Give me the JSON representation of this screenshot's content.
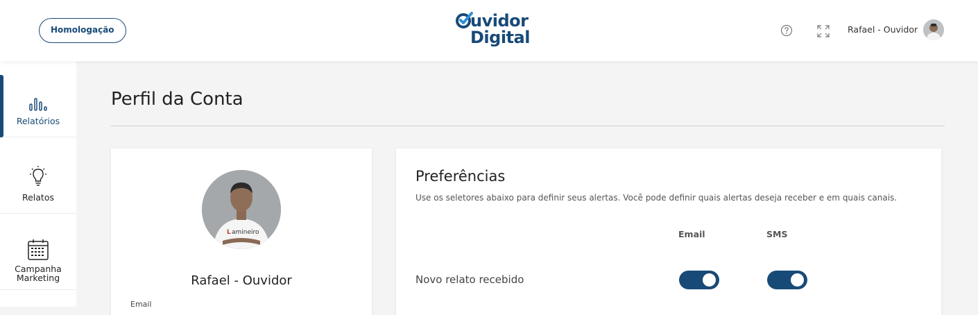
{
  "header": {
    "env_label": "Homologação",
    "logo_line1": "uvidor",
    "logo_line2": "Digital",
    "user_name": "Rafael - Ouvidor"
  },
  "sidebar": {
    "items": [
      {
        "label": "Relatórios",
        "icon": "bar-chart-icon",
        "active": true
      },
      {
        "label": "Relatos",
        "icon": "lightbulb-icon",
        "active": false
      },
      {
        "label_line1": "Campanha",
        "label_line2": "Marketing",
        "icon": "calendar-icon",
        "active": false
      }
    ]
  },
  "main": {
    "title": "Perfil da Conta",
    "profile": {
      "name": "Rafael - Ouvidor",
      "email_label": "Email"
    },
    "preferences": {
      "title": "Preferências",
      "description": "Use os seletores abaixo para definir seus alertas. Você pode definir quais alertas deseja receber e em quais canais.",
      "columns": [
        "Email",
        "SMS"
      ],
      "rows": [
        {
          "label": "Novo relato recebido",
          "email": true,
          "sms": true
        }
      ]
    }
  },
  "colors": {
    "brand": "#184a78",
    "logo_check": "#2f8fd6",
    "background": "#f4f4f4"
  }
}
